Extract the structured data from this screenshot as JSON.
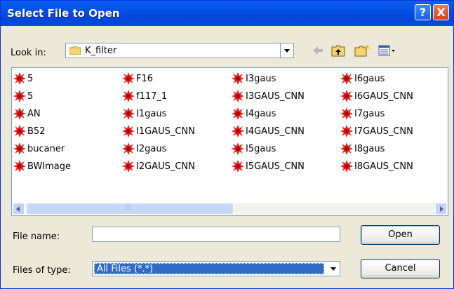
{
  "window": {
    "title": "Select File to Open",
    "help_label": "?",
    "close_label": "X"
  },
  "look_in": {
    "label": "Look in:",
    "value": "K_filter"
  },
  "toolbar": [
    "back-icon",
    "up-folder-icon",
    "new-folder-icon",
    "view-menu-icon"
  ],
  "files": [
    [
      "5",
      "5",
      "AN",
      "B52",
      "bucaner",
      "BWImage"
    ],
    [
      "F16",
      "f117_1",
      "I1gaus",
      "I1GAUS_CNN",
      "I2gaus",
      "I2GAUS_CNN"
    ],
    [
      "I3gaus",
      "I3GAUS_CNN",
      "I4gaus",
      "I4GAUS_CNN",
      "I5gaus",
      "I5GAUS_CNN"
    ],
    [
      "I6gaus",
      "I6GAUS_CNN",
      "I7gaus",
      "I7GAUS_CNN",
      "I8gaus",
      "I8GAUS_CNN"
    ]
  ],
  "file_name": {
    "label": "File name:",
    "value": ""
  },
  "file_type": {
    "label": "Files of type:",
    "value": "All Files (*.*)"
  },
  "buttons": {
    "open": "Open",
    "cancel": "Cancel"
  },
  "colors": {
    "titlebar": "#0451e6",
    "file_icon": "#e02020",
    "selection": "#316ac5"
  }
}
